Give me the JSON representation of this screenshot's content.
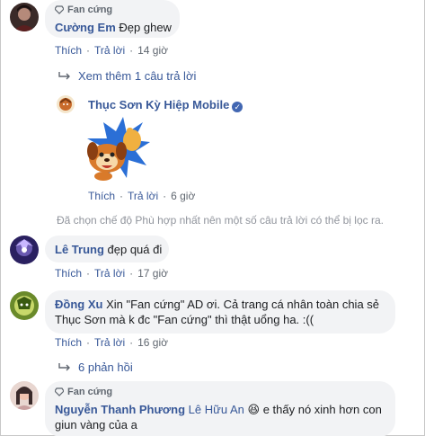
{
  "badge_label": "Fan cứng",
  "actions": {
    "like": "Thích",
    "reply": "Trả lời",
    "dot": "·"
  },
  "comments": [
    {
      "author": "Cường Em",
      "text": "Đẹp ghew",
      "time": "14 giờ"
    },
    {
      "author": "Lê Trung",
      "text": "đẹp quá đi",
      "time": "17 giờ"
    },
    {
      "author": "Đồng Xu",
      "text_line1": "Xin \"Fan cứng\" AD ơi. Cả trang cá nhân toàn chia sẻ",
      "text_line2": "Thục Sơn mà k đc \"Fan cứng\" thì thật uổng ha. :((",
      "time": "16 giờ"
    },
    {
      "author": "Nguyễn Thanh Phương",
      "mention": "Lê Hữu An",
      "emoji": "😆",
      "text_line1": "e thấy nó xinh hơn con",
      "text_line2": "giun vàng của a"
    }
  ],
  "view_more_reply": "Xem thêm 1 câu trả lời",
  "page_reply": {
    "author": "Thục Sơn Kỳ Hiệp Mobile",
    "time": "6 giờ",
    "verified_glyph": "✓"
  },
  "filter_notice": "Đã chọn chế độ Phù hợp nhất nên một số câu trả lời có thể bị lọc ra.",
  "reply_count_label": "6 phản hồi",
  "colors": {
    "link": "#385898",
    "bubble": "#f2f3f5",
    "meta": "#606770",
    "notice": "#90949c",
    "verified": "#4267b2"
  },
  "icons": {
    "badge": "diamond-icon",
    "reply_arrow": "reply-arrow-icon"
  }
}
